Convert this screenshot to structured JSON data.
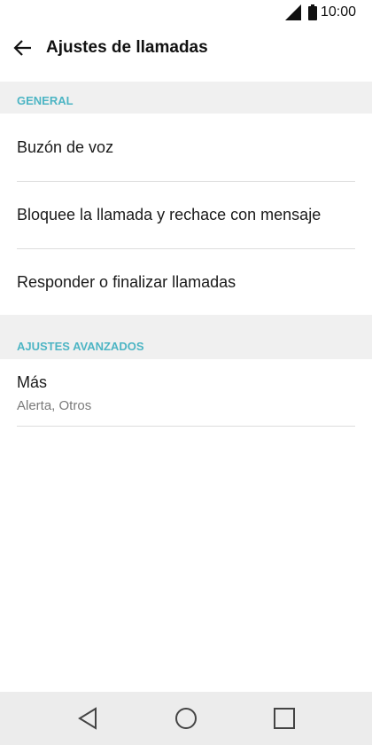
{
  "status_bar": {
    "time": "10:00",
    "signal_icon": "signal-icon",
    "battery_icon": "battery-icon"
  },
  "app_bar": {
    "back_icon": "arrow-back-icon",
    "title": "Ajustes de llamadas"
  },
  "sections": {
    "general": {
      "header": "GENERAL",
      "items": [
        {
          "label": "Buzón de voz"
        },
        {
          "label": "Bloquee la llamada y rechace con mensaje"
        },
        {
          "label": "Responder o finalizar llamadas"
        }
      ]
    },
    "advanced": {
      "header": "AJUSTES AVANZADOS",
      "items": [
        {
          "label": "Más",
          "sublabel": "Alerta, Otros"
        }
      ]
    }
  },
  "nav_bar": {
    "back_icon": "nav-back-triangle-icon",
    "home_icon": "nav-home-circle-icon",
    "recents_icon": "nav-recents-square-icon"
  },
  "colors": {
    "accent": "#4db5c4",
    "section_bg": "#f0f0f0",
    "nav_bg": "#ececec"
  }
}
